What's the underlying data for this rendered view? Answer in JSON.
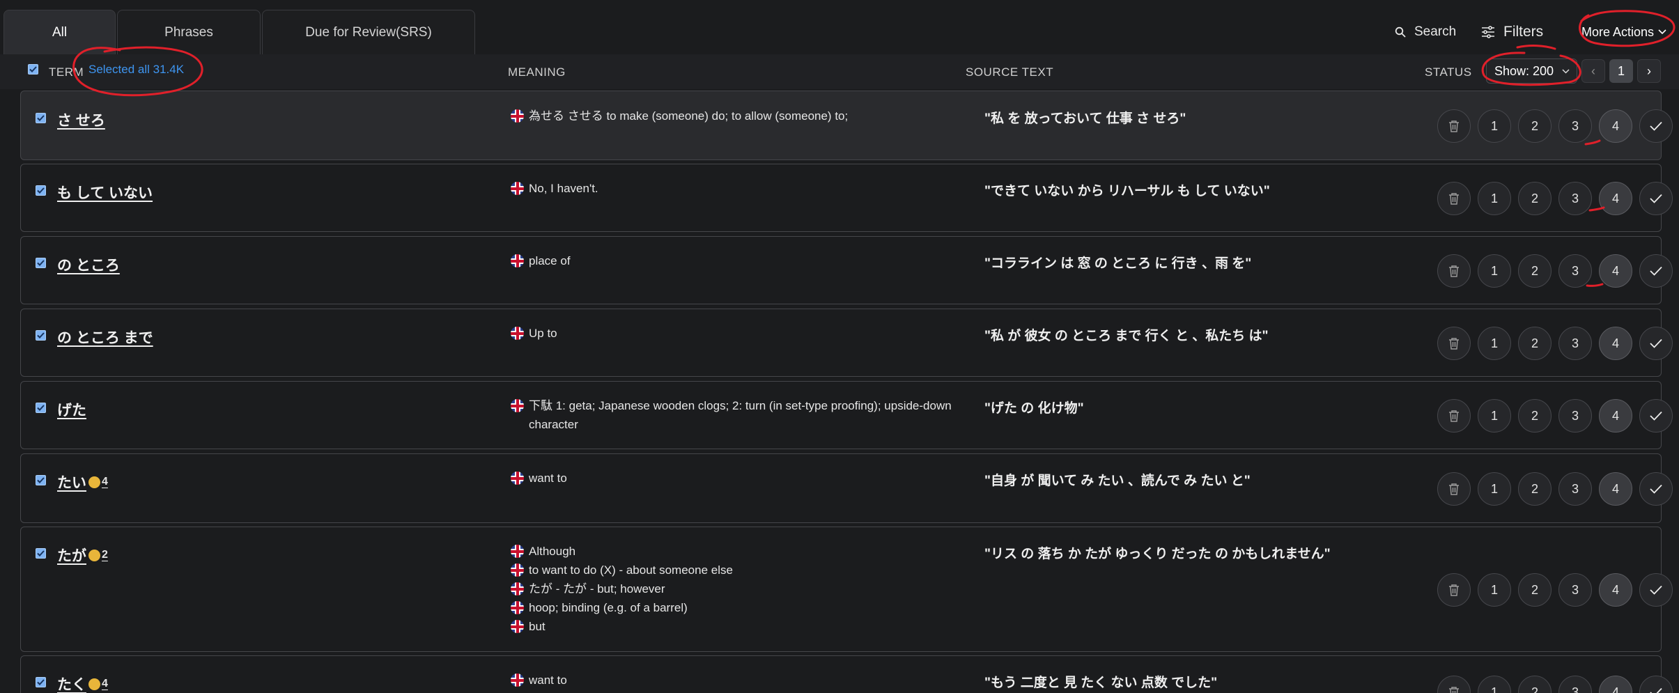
{
  "tabs": [
    {
      "label": "All",
      "active": true
    },
    {
      "label": "Phrases",
      "active": false
    },
    {
      "label": "Due for Review(SRS)",
      "active": false
    }
  ],
  "toolbar": {
    "search_label": "Search",
    "filters_label": "Filters",
    "more_actions_label": "More Actions"
  },
  "header": {
    "term": "TERM",
    "selected_all": "Selected all 31.4K",
    "meaning": "MEANING",
    "source_text": "SOURCE TEXT",
    "status": "STATUS",
    "show_label": "Show: 200",
    "page": "1"
  },
  "status_buttons": [
    "1",
    "2",
    "3",
    "4"
  ],
  "rows": [
    {
      "term": "さ せろ",
      "badge": "",
      "meanings": [
        "為せる させる to make (someone) do; to allow (someone) to;"
      ],
      "source": "\"私 を 放っておいて 仕事 さ せろ\""
    },
    {
      "term": "も して いない",
      "badge": "",
      "meanings": [
        "No, I haven't."
      ],
      "source": "\"できて いない から リハーサル も して いない\""
    },
    {
      "term": "の ところ",
      "badge": "",
      "meanings": [
        "place of"
      ],
      "source": "\"コラライン は 窓 の ところ に 行き 、雨 を\""
    },
    {
      "term": "の ところ まで",
      "badge": "",
      "meanings": [
        "Up to"
      ],
      "source": "\"私 が 彼女 の ところ まで 行く と 、私たち は\""
    },
    {
      "term": "げた",
      "badge": "",
      "meanings": [
        "下駄 1: geta; Japanese wooden clogs; 2: turn (in set-type proofing); upside-down character"
      ],
      "source": "\"げた の 化け物\""
    },
    {
      "term": "たい",
      "badge": "4",
      "meanings": [
        "want to"
      ],
      "source": "\"自身 が 聞いて み たい 、読んで み たい と\""
    },
    {
      "term": "たが",
      "badge": "2",
      "meanings": [
        "Although",
        "to want to do (X) - about someone else",
        "たが - たが - but; however",
        "hoop; binding (e.g. of a barrel)",
        "but"
      ],
      "source": "\"リス の 落ち か たが ゆっくり だった の かもしれません\""
    },
    {
      "term": "たく",
      "badge": "4",
      "meanings": [
        "want to"
      ],
      "source": "\"もう 二度と 見 たく ない 点数 でした\""
    }
  ]
}
